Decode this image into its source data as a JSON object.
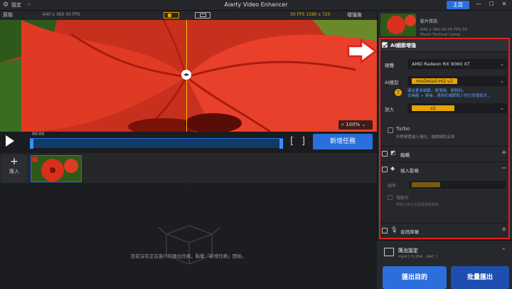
{
  "titlebar": {
    "settings": "設定",
    "title": "Aiarty Video Enhancer",
    "home": "主頁"
  },
  "preview": {
    "original_label": "原始",
    "original_res": "640 x 360   30 FPS",
    "enhanced_res": "30 FPS   1280 x 720",
    "after_label": "增強後",
    "zoom": "100%"
  },
  "controls": {
    "time": "00:00",
    "new_task": "新增任務"
  },
  "queue": {
    "import_label": "匯入",
    "empty_text": "目前沒有正在進行的匯出任務，點擊「新增任務」開始。"
  },
  "video_info": {
    "label": "影片資訊:",
    "meta": [
      "640 x 360  00:05      FPS 30",
      "Music Festival Camp..."
    ]
  },
  "enhance": {
    "title": "AI細節增強",
    "gpu_label": "硬體",
    "gpu_value": "AMD Radeon RX 9060 XT",
    "model_label": "AI模型",
    "model_value": "moDetail-HQ  v2",
    "model_hint": "適合更多細節，更清晰，更銳利。\n去噪點 + 降噪，適用於細節較少的已修復影片。",
    "scale_label": "放大",
    "scale_value": "x2",
    "turbo_title": "Turbo",
    "turbo_desc": "針對硬體進行優化，略微犧牲品質",
    "crop_label": "編輯",
    "interp_label": "插入影格",
    "fr_label": "幀率",
    "fr_check": "慢動作",
    "fr_desc": "僅影片部分且配置降低幀率",
    "audio_label": "音訊降噪"
  },
  "export": {
    "title": "匯出設定",
    "desc": "mp4 [ H.264 , AAC ]",
    "target": "匯出目的",
    "batch": "批量匯出"
  },
  "colors": {
    "accent": "#2a6fdb",
    "highlight": "#e0201c",
    "yellow": "#e8a400"
  }
}
